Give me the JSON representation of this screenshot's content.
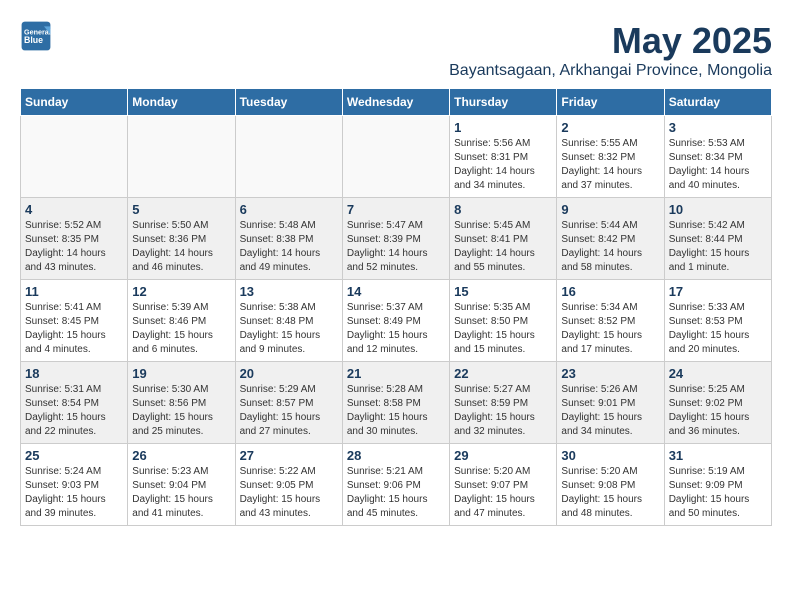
{
  "logo": {
    "line1": "General",
    "line2": "Blue"
  },
  "title": "May 2025",
  "subtitle": "Bayantsagaan, Arkhangai Province, Mongolia",
  "weekdays": [
    "Sunday",
    "Monday",
    "Tuesday",
    "Wednesday",
    "Thursday",
    "Friday",
    "Saturday"
  ],
  "weeks": [
    [
      {
        "day": "",
        "info": ""
      },
      {
        "day": "",
        "info": ""
      },
      {
        "day": "",
        "info": ""
      },
      {
        "day": "",
        "info": ""
      },
      {
        "day": "1",
        "info": "Sunrise: 5:56 AM\nSunset: 8:31 PM\nDaylight: 14 hours\nand 34 minutes."
      },
      {
        "day": "2",
        "info": "Sunrise: 5:55 AM\nSunset: 8:32 PM\nDaylight: 14 hours\nand 37 minutes."
      },
      {
        "day": "3",
        "info": "Sunrise: 5:53 AM\nSunset: 8:34 PM\nDaylight: 14 hours\nand 40 minutes."
      }
    ],
    [
      {
        "day": "4",
        "info": "Sunrise: 5:52 AM\nSunset: 8:35 PM\nDaylight: 14 hours\nand 43 minutes."
      },
      {
        "day": "5",
        "info": "Sunrise: 5:50 AM\nSunset: 8:36 PM\nDaylight: 14 hours\nand 46 minutes."
      },
      {
        "day": "6",
        "info": "Sunrise: 5:48 AM\nSunset: 8:38 PM\nDaylight: 14 hours\nand 49 minutes."
      },
      {
        "day": "7",
        "info": "Sunrise: 5:47 AM\nSunset: 8:39 PM\nDaylight: 14 hours\nand 52 minutes."
      },
      {
        "day": "8",
        "info": "Sunrise: 5:45 AM\nSunset: 8:41 PM\nDaylight: 14 hours\nand 55 minutes."
      },
      {
        "day": "9",
        "info": "Sunrise: 5:44 AM\nSunset: 8:42 PM\nDaylight: 14 hours\nand 58 minutes."
      },
      {
        "day": "10",
        "info": "Sunrise: 5:42 AM\nSunset: 8:44 PM\nDaylight: 15 hours\nand 1 minute."
      }
    ],
    [
      {
        "day": "11",
        "info": "Sunrise: 5:41 AM\nSunset: 8:45 PM\nDaylight: 15 hours\nand 4 minutes."
      },
      {
        "day": "12",
        "info": "Sunrise: 5:39 AM\nSunset: 8:46 PM\nDaylight: 15 hours\nand 6 minutes."
      },
      {
        "day": "13",
        "info": "Sunrise: 5:38 AM\nSunset: 8:48 PM\nDaylight: 15 hours\nand 9 minutes."
      },
      {
        "day": "14",
        "info": "Sunrise: 5:37 AM\nSunset: 8:49 PM\nDaylight: 15 hours\nand 12 minutes."
      },
      {
        "day": "15",
        "info": "Sunrise: 5:35 AM\nSunset: 8:50 PM\nDaylight: 15 hours\nand 15 minutes."
      },
      {
        "day": "16",
        "info": "Sunrise: 5:34 AM\nSunset: 8:52 PM\nDaylight: 15 hours\nand 17 minutes."
      },
      {
        "day": "17",
        "info": "Sunrise: 5:33 AM\nSunset: 8:53 PM\nDaylight: 15 hours\nand 20 minutes."
      }
    ],
    [
      {
        "day": "18",
        "info": "Sunrise: 5:31 AM\nSunset: 8:54 PM\nDaylight: 15 hours\nand 22 minutes."
      },
      {
        "day": "19",
        "info": "Sunrise: 5:30 AM\nSunset: 8:56 PM\nDaylight: 15 hours\nand 25 minutes."
      },
      {
        "day": "20",
        "info": "Sunrise: 5:29 AM\nSunset: 8:57 PM\nDaylight: 15 hours\nand 27 minutes."
      },
      {
        "day": "21",
        "info": "Sunrise: 5:28 AM\nSunset: 8:58 PM\nDaylight: 15 hours\nand 30 minutes."
      },
      {
        "day": "22",
        "info": "Sunrise: 5:27 AM\nSunset: 8:59 PM\nDaylight: 15 hours\nand 32 minutes."
      },
      {
        "day": "23",
        "info": "Sunrise: 5:26 AM\nSunset: 9:01 PM\nDaylight: 15 hours\nand 34 minutes."
      },
      {
        "day": "24",
        "info": "Sunrise: 5:25 AM\nSunset: 9:02 PM\nDaylight: 15 hours\nand 36 minutes."
      }
    ],
    [
      {
        "day": "25",
        "info": "Sunrise: 5:24 AM\nSunset: 9:03 PM\nDaylight: 15 hours\nand 39 minutes."
      },
      {
        "day": "26",
        "info": "Sunrise: 5:23 AM\nSunset: 9:04 PM\nDaylight: 15 hours\nand 41 minutes."
      },
      {
        "day": "27",
        "info": "Sunrise: 5:22 AM\nSunset: 9:05 PM\nDaylight: 15 hours\nand 43 minutes."
      },
      {
        "day": "28",
        "info": "Sunrise: 5:21 AM\nSunset: 9:06 PM\nDaylight: 15 hours\nand 45 minutes."
      },
      {
        "day": "29",
        "info": "Sunrise: 5:20 AM\nSunset: 9:07 PM\nDaylight: 15 hours\nand 47 minutes."
      },
      {
        "day": "30",
        "info": "Sunrise: 5:20 AM\nSunset: 9:08 PM\nDaylight: 15 hours\nand 48 minutes."
      },
      {
        "day": "31",
        "info": "Sunrise: 5:19 AM\nSunset: 9:09 PM\nDaylight: 15 hours\nand 50 minutes."
      }
    ]
  ]
}
